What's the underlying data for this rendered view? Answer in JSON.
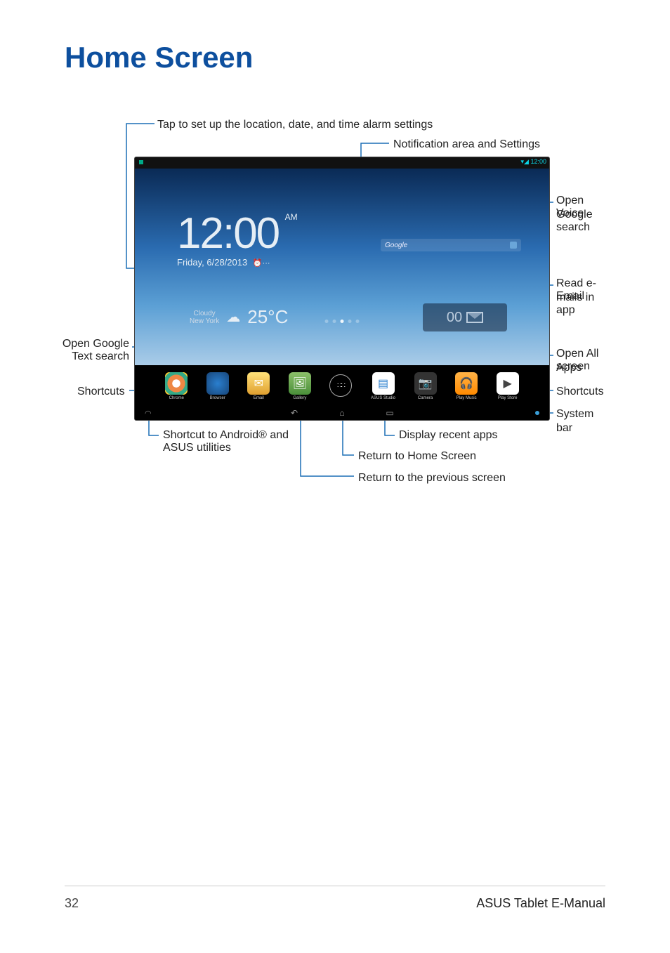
{
  "title": "Home Screen",
  "callouts": {
    "top1": "Tap to set up the location, date, and time alarm settings",
    "top2": "Notification area and Settings",
    "right1a": "Open Google",
    "right1b": "Voice search",
    "right2a": "Read e-mails in",
    "right2b": "Email app",
    "right3a": "Open All Apps",
    "right3b": "screen",
    "right4": "Shortcuts",
    "right5": "System bar",
    "left1a": "Open Google",
    "left1b": "Text search",
    "left2": "Shortcuts",
    "bottom1a": "Shortcut to Android® and",
    "bottom1b": "ASUS utilities",
    "bottom2": "Display recent apps",
    "bottom3": "Return to Home Screen",
    "bottom4": "Return to the previous screen"
  },
  "tablet": {
    "status_time": "12:00",
    "clock_time": "12:00",
    "clock_ampm": "AM",
    "clock_date": "Friday, 6/28/2013",
    "weather_cond": "Cloudy",
    "weather_city": "New York",
    "weather_temp": "25°C",
    "google_label": "Google",
    "email_count": "00",
    "dock": [
      "Chrome",
      "Browser",
      "Email",
      "Gallery",
      "",
      "ASUS Studio",
      "Camera",
      "Play Music",
      "Play Store"
    ]
  },
  "footer": {
    "page": "32",
    "title": "ASUS Tablet E-Manual"
  },
  "colors": {
    "heading": "#0d4f9e",
    "line": "#1b6fb5"
  }
}
